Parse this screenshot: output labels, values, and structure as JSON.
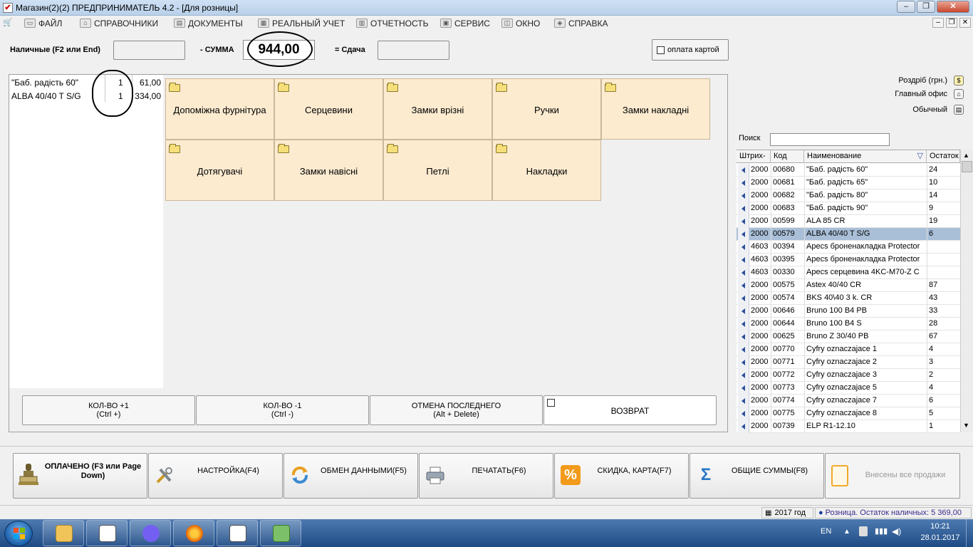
{
  "window": {
    "title": "Магазин(2)(2)  ПРЕДПРИНИМАТЕЛЬ 4.2 - [Для розницы]"
  },
  "menu": [
    "ФАЙЛ",
    "СПРАВОЧНИКИ",
    "ДОКУМЕНТЫ",
    "РЕАЛЬНЫЙ УЧЕТ",
    "ОТЧЕТНОСТЬ",
    "СЕРВИС",
    "ОКНО",
    "СПРАВКА"
  ],
  "payment": {
    "cash_label": "Наличные (F2 или End)",
    "cash_value": "",
    "sum_label": "- СУММА",
    "sum_value": "944,00",
    "change_label": "= Сдача",
    "change_value": "",
    "card_label": "оплата картой"
  },
  "order": [
    {
      "name": "\"Баб. радість 60\"",
      "qty": "1",
      "price": "61,00"
    },
    {
      "name": "ALBA 40/40 T S/G",
      "qty": "1",
      "price": "334,00"
    }
  ],
  "categories": [
    "Допоміжна фурнітура",
    "Серцевини",
    "Замки врізні",
    "Ручки",
    "Замки накладні",
    "Дотягувачі",
    "Замки навісні",
    "Петлі",
    "Накладки"
  ],
  "actions": {
    "qty_plus": {
      "label": "КОЛ-ВО +1",
      "key": "(Ctrl +)"
    },
    "qty_minus": {
      "label": "КОЛ-ВО -1",
      "key": "(Ctrl -)"
    },
    "cancel_last": {
      "label": "ОТМЕНА ПОСЛЕДНЕГО",
      "key": "(Alt + Delete)"
    },
    "return": {
      "label": "ВОЗВРАТ"
    }
  },
  "right": {
    "price_type": "Роздріб (грн.)",
    "office": "Главный офис",
    "print_mode": "Обычный",
    "search_label": "Поиск",
    "search_value": ""
  },
  "grid": {
    "headers": [
      "Штрих-",
      "Код",
      "Наименование",
      "Остаток"
    ],
    "rows": [
      [
        "2000",
        "00680",
        "\"Баб. радість 60\"",
        "24"
      ],
      [
        "2000",
        "00681",
        "\"Баб. радість 65\"",
        "10"
      ],
      [
        "2000",
        "00682",
        "\"Баб. радість 80\"",
        "14"
      ],
      [
        "2000",
        "00683",
        "\"Баб. радість 90\"",
        "9"
      ],
      [
        "2000",
        "00599",
        "ALA 85 CR",
        "19"
      ],
      [
        "2000",
        "00579",
        "ALBA 40/40 T S/G",
        "6"
      ],
      [
        "4603",
        "00394",
        "Apecs броненакладка Protector",
        ""
      ],
      [
        "4603",
        "00395",
        "Apecs броненакладка Protector",
        ""
      ],
      [
        "4603",
        "00330",
        "Apecs серцевина 4KC-M70-Z C",
        ""
      ],
      [
        "2000",
        "00575",
        "Astex 40/40 CR",
        "87"
      ],
      [
        "2000",
        "00574",
        "BKS 40\\40 3 k.  CR",
        "43"
      ],
      [
        "2000",
        "00646",
        "Bruno 100 B4 PB",
        "33"
      ],
      [
        "2000",
        "00644",
        "Bruno 100 B4 S",
        "28"
      ],
      [
        "2000",
        "00625",
        "Bruno Z 30/40 PB",
        "67"
      ],
      [
        "2000",
        "00770",
        "Cyfry oznaczajace 1",
        "4"
      ],
      [
        "2000",
        "00771",
        "Cyfry oznaczajace 2",
        "3"
      ],
      [
        "2000",
        "00772",
        "Cyfry oznaczajace 3",
        "2"
      ],
      [
        "2000",
        "00773",
        "Cyfry oznaczajace 5",
        "4"
      ],
      [
        "2000",
        "00774",
        "Cyfry oznaczajace 7",
        "6"
      ],
      [
        "2000",
        "00775",
        "Cyfry oznaczajace 8",
        "5"
      ],
      [
        "2000",
        "00739",
        "ELP R1-12.10",
        "1"
      ]
    ]
  },
  "bottom": {
    "paid": {
      "line1": "ОПЛАЧЕНО",
      "line2": "(F3 или",
      "line3": "Page Down)"
    },
    "settings": {
      "label": "НАСТРОЙКА",
      "key": "(F4)"
    },
    "exchange": {
      "label": "ОБМЕН ДАННЫМИ",
      "key": "(F5)"
    },
    "print": {
      "label": "ПЕЧАТАТЬ",
      "key": "(F6)"
    },
    "discount": {
      "label": "СКИДКА, КАРТА",
      "key": "(F7)"
    },
    "totals": {
      "label": "ОБЩИЕ СУММЫ",
      "key": "(F8)"
    },
    "sales_status": "Внесены все продажи"
  },
  "status": {
    "year": "2017 год",
    "cash_info": "Розница. Остаток наличных: 5 369,00"
  },
  "taskbar": {
    "lang": "EN",
    "time": "10:21",
    "date": "28.01.2017"
  },
  "colors": {
    "category_bg": "#fdebd0",
    "selected_row": "#a9bfd8",
    "taskbar": "#1f4b85"
  }
}
